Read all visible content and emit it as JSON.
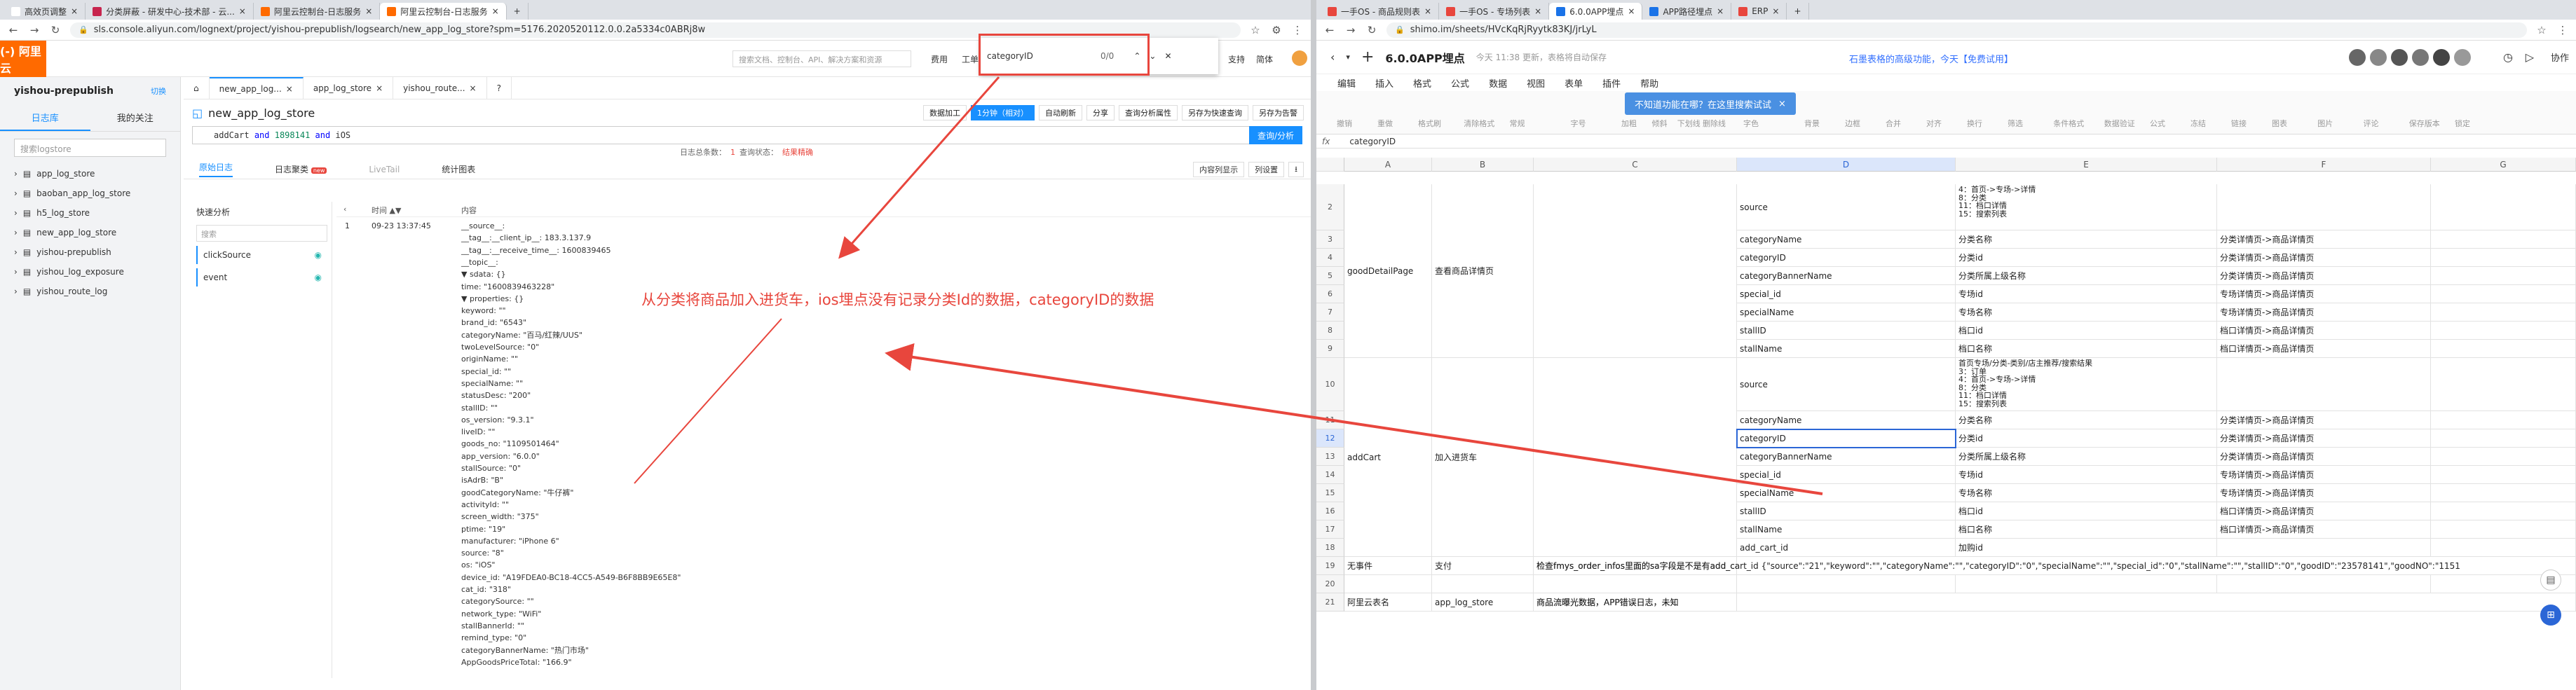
{
  "left_browser": {
    "tabs": [
      {
        "title": "高效页调整",
        "color": "#ffffff"
      },
      {
        "title": "分类屏蔽 - 研发中心-技术部 - 云...",
        "color": "#c7254e"
      },
      {
        "title": "阿里云控制台-日志服务",
        "color": "#ff6a00"
      },
      {
        "title": "阿里云控制台-日志服务",
        "color": "#ff6a00"
      }
    ],
    "url": "sls.console.aliyun.com/lognext/project/yishou-prepublish/logsearch/new_app_log_store?spm=5176.2020520112.0.0.2a5334c0ABRj8w"
  },
  "aliyun": {
    "logo": "(-) 阿里云",
    "search_placeholder": "搜索文档、控制台、API、解决方案和资源",
    "menu": [
      "费用",
      "工单",
      "备案",
      "支持",
      "简体"
    ],
    "project": "yishou-prepublish",
    "project_tag": "切换",
    "side_tabs": [
      "日志库",
      "我的关注"
    ],
    "side_search": "搜索logstore",
    "logstores": [
      "app_log_store",
      "baoban_app_log_store",
      "h5_log_store",
      "new_app_log_store",
      "yishou-prepublish",
      "yishou_log_exposure",
      "yishou_route_log"
    ],
    "log_tabs": [
      "new_app_log...",
      "app_log_store",
      "yishou_route..."
    ],
    "store_title": "new_app_log_store",
    "buttons": [
      "数据加工",
      "1分钟（相对）",
      "自动刷新",
      "分享",
      "查询分析属性",
      "另存为快速查询",
      "另存为告警"
    ],
    "query": {
      "p1": "addCart",
      "op1": "and",
      "p2": "1898141",
      "op2": "and",
      "p3": "iOS"
    },
    "query_btn": "查询/分析",
    "count_label": "日志总条数：",
    "count": "1",
    "status_label": "查询状态：",
    "status": "结果精确",
    "result_tabs": [
      "原始日志",
      "日志聚类",
      "LiveTail",
      "统计图表"
    ],
    "new_badge": "new",
    "right_btns": [
      "内容列显示",
      "列设置",
      "⭳"
    ],
    "quick_title": "快速分析",
    "quick_search": "搜索",
    "fields": [
      "clickSource",
      "event"
    ],
    "col_time": "时间 ▲▼",
    "col_content": "内容",
    "row_num": "1",
    "row_time": "09-23 13:37:45",
    "log_lines": [
      "__source__:",
      "__tag__:__client_ip__:   183.3.137.9",
      "__tag__:__receive_time__:   1600839465",
      "__topic__:",
      "▼ sdata:   {}",
      "   time:  \"1600839463228\"",
      "  ▼ properties:   {}",
      "      keyword:   \"\"",
      "      brand_id:   \"6543\"",
      "      categoryName:  \"百马/红辣/UUS\"",
      "      twoLevelSource:   \"0\"",
      "      originName:   \"\"",
      "      special_id:   \"\"",
      "      specialName:   \"\"",
      "      statusDesc:   \"200\"",
      "      stallID:   \"\"",
      "      os_version:   \"9.3.1\"",
      "      liveID:   \"\"",
      "      goods_no:   \"1109501464\"",
      "      app_version:   \"6.0.0\"",
      "      stallSource:   \"0\"",
      "      isAdrB:   \"B\"",
      "      goodCategoryName:  \"牛仔裤\"",
      "      activityId:   \"\"",
      "      screen_width:   \"375\"",
      "      ptime:   \"19\"",
      "      manufacturer:   \"iPhone 6\"",
      "      source:   \"8\"",
      "      os:   \"iOS\"",
      "      device_id:   \"A19FDEA0-BC18-4CC5-A549-B6F8BB9E65E8\"",
      "      cat_id:   \"318\"",
      "      categorySource:   \"\"",
      "      network_type:   \"WiFi\"",
      "      stallBannerId:   \"\"",
      "      remind_type:   \"0\"",
      "      categoryBannerName:  \"热门市场\"",
      "      AppGoodsPriceTotal:   \"166.9\""
    ]
  },
  "find_bar": {
    "query": "categoryID",
    "count": "0/0"
  },
  "annotation": "从分类将商品加入进货车，ios埋点没有记录分类Id的数据，categoryID的数据",
  "right_browser": {
    "tabs": [
      {
        "title": "一手OS - 商品规则表",
        "color": "#e8463d"
      },
      {
        "title": "一手OS - 专场列表",
        "color": "#e8463d"
      },
      {
        "title": "6.0.0APP埋点",
        "color": "#1a73e8"
      },
      {
        "title": "APP路径埋点",
        "color": "#1a73e8"
      },
      {
        "title": "ERP",
        "color": "#e8463d"
      }
    ],
    "url": "shimo.im/sheets/HVcKqRjRyytk83KJ/jrLyL"
  },
  "shimo": {
    "title": "6.0.0APP埋点",
    "saved": "今天 11:38 更新，表格将自动保存",
    "promo": "石墨表格的高级功能，今天【免费试用】",
    "collab": "协作",
    "menu": [
      "编辑",
      "插入",
      "格式",
      "公式",
      "数据",
      "视图",
      "表单",
      "插件",
      "帮助"
    ],
    "toolbar": [
      "撤销",
      "重做",
      "格式刷",
      "清除格式",
      "常规",
      "字号",
      "加粗",
      "倾斜",
      "下划线",
      "删除线",
      "字色",
      "背景",
      "边框",
      "合并",
      "对齐",
      "换行",
      "筛选",
      "条件格式",
      "数据验证",
      "公式",
      "冻结",
      "链接",
      "图表",
      "图片",
      "评论",
      "保存版本",
      "锁定"
    ],
    "tooltip": "不知道功能在哪？在这里搜索试试",
    "cell_ref": "fx",
    "formula": "categoryID",
    "columns": [
      "A",
      "B",
      "C",
      "D",
      "E",
      "F",
      "G"
    ],
    "rows": {
      "2": {
        "D": "source",
        "E": "4：首页->专场->详情\n8：分类\n11：档口详情\n15：搜索列表",
        "F": ""
      },
      "3": {
        "D": "categoryName",
        "E": "分类名称",
        "F": "分类详情页->商品详情页"
      },
      "4": {
        "A": "goodDetailPage",
        "B": "查看商品详情页",
        "D": "categoryID",
        "E": "分类id",
        "F": "分类详情页->商品详情页"
      },
      "5": {
        "D": "categoryBannerName",
        "E": "分类所属上级名称",
        "F": "分类详情页->商品详情页"
      },
      "6": {
        "D": "special_id",
        "E": "专场id",
        "F": "专场详情页->商品详情页"
      },
      "7": {
        "D": "specialName",
        "E": "专场名称",
        "F": "专场详情页->商品详情页"
      },
      "8": {
        "D": "stallID",
        "E": "档口id",
        "F": "档口详情页->商品详情页"
      },
      "9": {
        "D": "stallName",
        "E": "档口名称",
        "F": "档口详情页->商品详情页"
      },
      "10": {
        "D": "source",
        "E": "首页专场/分类-类别/店主推荐/搜索结果\n3：订单\n4：首页->专场->详情\n8：分类\n11：档口详情\n15：搜索列表",
        "F": ""
      },
      "11": {
        "D": "categoryName",
        "E": "分类名称",
        "F": "分类详情页->商品详情页"
      },
      "12": {
        "A": "addCart",
        "B": "加入进货车",
        "D": "categoryID",
        "E": "分类id",
        "F": "分类详情页->商品详情页"
      },
      "13": {
        "D": "categoryBannerName",
        "E": "分类所属上级名称",
        "F": "分类详情页->商品详情页"
      },
      "14": {
        "D": "special_id",
        "E": "专场id",
        "F": "专场详情页->商品详情页"
      },
      "15": {
        "D": "specialName",
        "E": "专场名称",
        "F": "专场详情页->商品详情页"
      },
      "16": {
        "D": "stallID",
        "E": "档口id",
        "F": "档口详情页->商品详情页"
      },
      "17": {
        "D": "stallName",
        "E": "档口名称",
        "F": "档口详情页->商品详情页"
      },
      "18": {
        "D": "add_cart_id",
        "E": "加购id",
        "F": ""
      },
      "19": {
        "A": "无事件",
        "B": "支付",
        "C": "检查fmys_order_infos里面的sa字段是不是有add_cart_id {\"source\":\"21\",\"keyword\":\"\",\"categoryName\":\"\",\"categoryID\":\"0\",\"specialName\":\"\",\"special_id\":\"0\",\"stallName\":\"\",\"stallID\":\"0\",\"goodID\":\"23578141\",\"goodNO\":\"1151"
      },
      "20": {},
      "21": {
        "A": "阿里云表名",
        "B": "app_log_store",
        "C": "商品流曝光数据，APP错误日志，未知"
      }
    }
  },
  "colors": {
    "aliyun_orange": "#ff6a00",
    "link_blue": "#1890ff",
    "annot_red": "#e8463d",
    "select_blue": "#2b66d6"
  }
}
